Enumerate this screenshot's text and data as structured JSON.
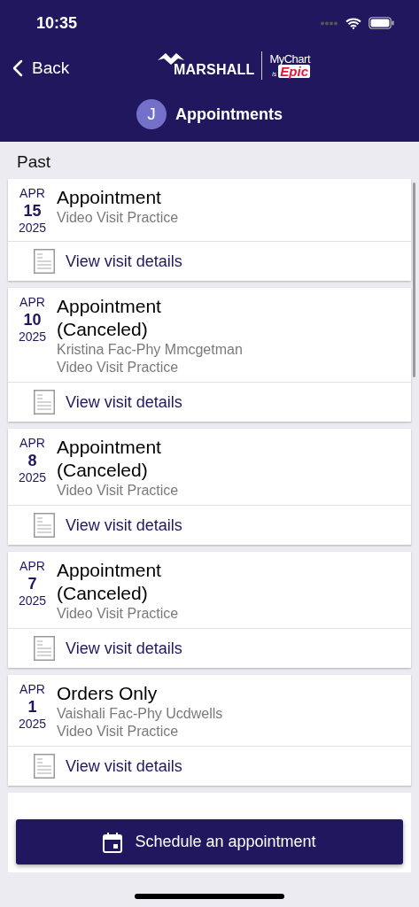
{
  "status_bar": {
    "time": "10:35"
  },
  "nav": {
    "back": "Back",
    "logo": {
      "brand": "MARSHALL",
      "product": "MyChart",
      "tag_prefix": "is",
      "tag": "Epic"
    }
  },
  "title": {
    "avatar": "J",
    "text": "Appointments"
  },
  "section": "Past",
  "appointments": [
    {
      "month": "APR",
      "day": "15",
      "year": "2025",
      "title": "Appointment",
      "lines": [
        "Video Visit Practice"
      ],
      "link": "View visit details"
    },
    {
      "month": "APR",
      "day": "10",
      "year": "2025",
      "title": "Appointment (Canceled)",
      "lines": [
        "Kristina Fac-Phy Mmcgetman",
        "Video Visit Practice"
      ],
      "link": "View visit details"
    },
    {
      "month": "APR",
      "day": "8",
      "year": "2025",
      "title": "Appointment (Canceled)",
      "lines": [
        "Video Visit Practice"
      ],
      "link": "View visit details"
    },
    {
      "month": "APR",
      "day": "7",
      "year": "2025",
      "title": "Appointment (Canceled)",
      "lines": [
        "Video Visit Practice"
      ],
      "link": "View visit details"
    },
    {
      "month": "APR",
      "day": "1",
      "year": "2025",
      "title": "Orders Only",
      "lines": [
        "Vaishali Fac-Phy Ucdwells",
        "Video Visit Practice"
      ],
      "link": "View visit details"
    }
  ],
  "schedule_button": "Schedule an appointment"
}
